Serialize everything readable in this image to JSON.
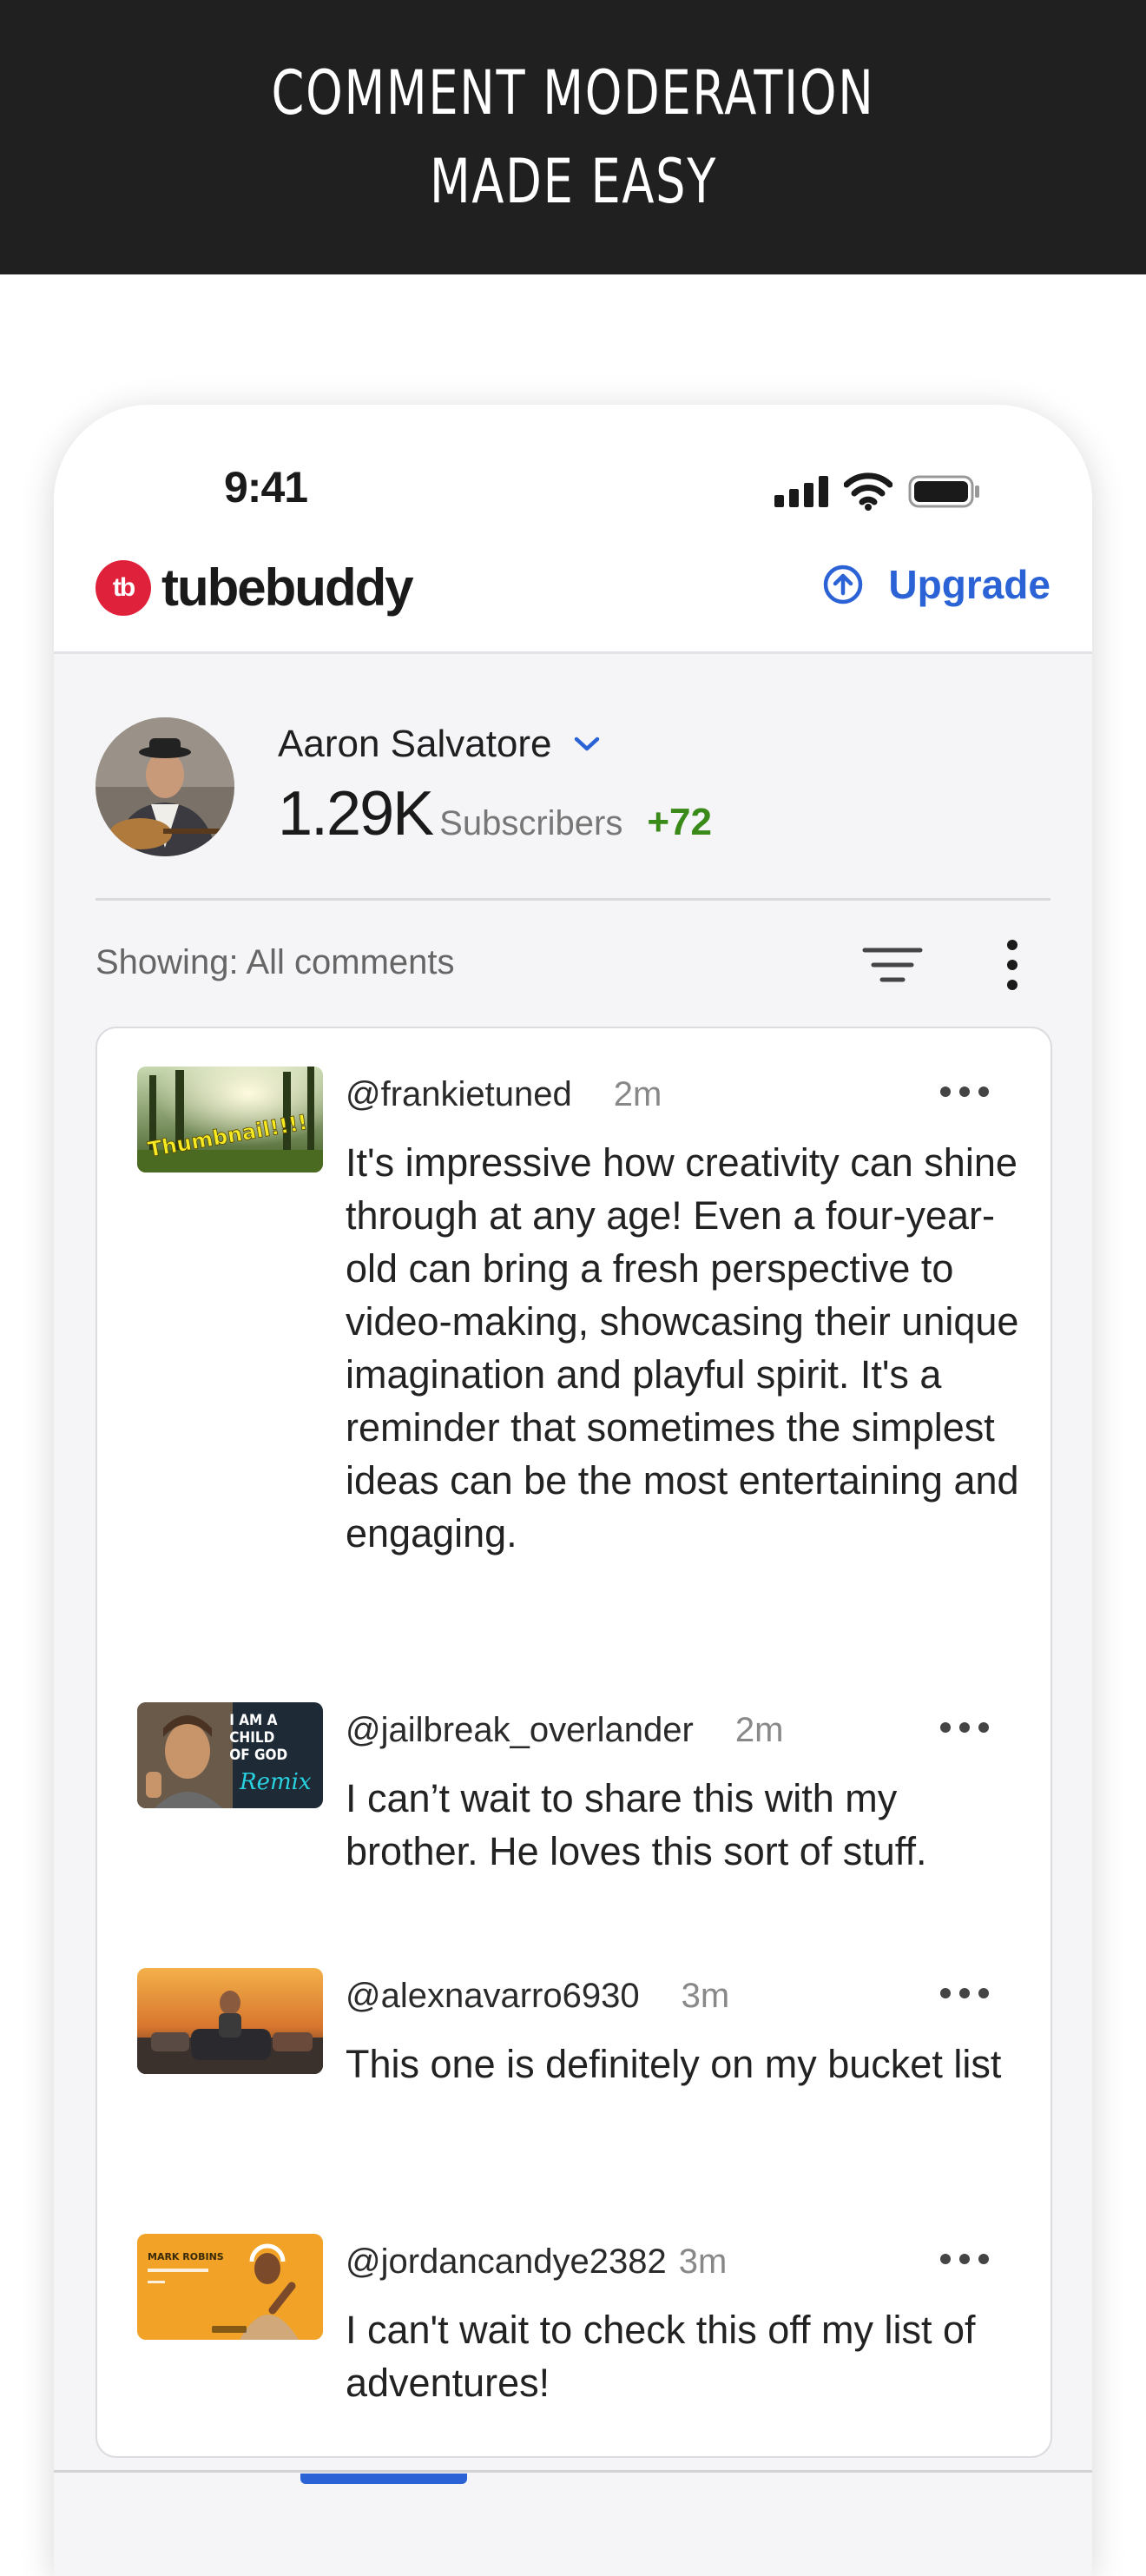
{
  "banner": {
    "line1": "COMMENT MODERATION",
    "line2": "MADE EASY"
  },
  "status_bar": {
    "time": "9:41"
  },
  "app": {
    "brand": "tubebuddy",
    "brand_mark": "tb",
    "brand_color": "#e0213c",
    "accent_color": "#2b63d6",
    "upgrade_label": "Upgrade"
  },
  "channel": {
    "name": "Aaron Salvatore",
    "subscribers": "1.29K",
    "subscribers_label": "Subscribers",
    "delta": "+72",
    "delta_color": "#3a8a1a"
  },
  "filter": {
    "showing": "Showing: All comments"
  },
  "comments": [
    {
      "author": "@frankietuned",
      "time": "2m",
      "text": "It's impressive how creativity can shine through at any age! Even a four-year-old can bring a fresh perspective to video-making, showcasing their unique imagination and playful spirit. It's a reminder that sometimes the simplest ideas can be the most entertaining and engaging.",
      "thumb_text": "Thumbnail!!!!"
    },
    {
      "author": "@jailbreak_overlander",
      "time": "2m",
      "text": "I can’t wait to share this with my brother. He loves this sort of stuff.",
      "thumb_text": "I AM A CHILD OF GOD",
      "thumb_script": "Remix"
    },
    {
      "author": "@alexnavarro6930",
      "time": "3m",
      "text": "This one is definitely on my bucket list"
    },
    {
      "author": "@jordancandye2382",
      "time": "3m",
      "text": "I can't wait to check this off my list of adventures!",
      "thumb_text": "MARK ROBINS"
    }
  ]
}
